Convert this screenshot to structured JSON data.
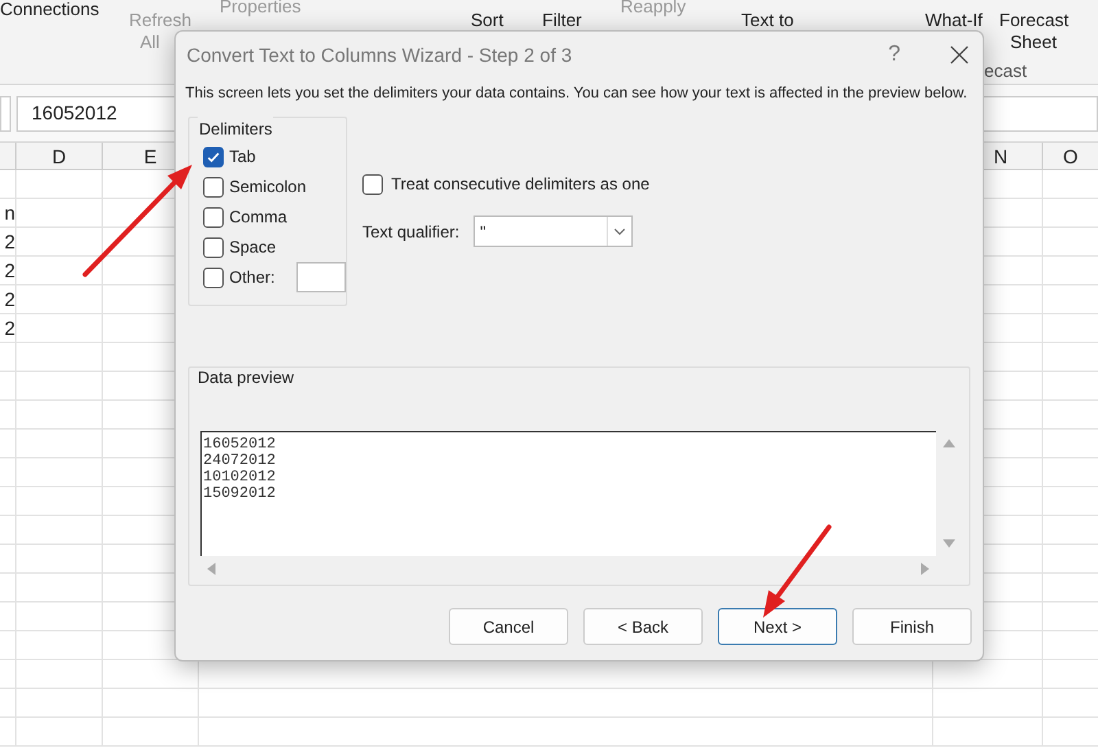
{
  "ribbon": {
    "items": [
      {
        "label": "Connections"
      },
      {
        "label": "Refresh"
      },
      {
        "label": "All"
      },
      {
        "label": "Properties"
      },
      {
        "label": "Sort"
      },
      {
        "label": "Filter"
      },
      {
        "label": "Reapply"
      },
      {
        "label": "Text to"
      },
      {
        "label": "What-If"
      },
      {
        "label": "Forecast"
      },
      {
        "label": "Sheet"
      },
      {
        "label": "ecast"
      }
    ]
  },
  "formula_bar": {
    "value": "16052012"
  },
  "sheet": {
    "columns": [
      "D",
      "E",
      "N",
      "O"
    ],
    "cells": [
      "n",
      "2",
      "2",
      "2",
      "2"
    ]
  },
  "dialog": {
    "title": "Convert Text to Columns Wizard - Step 2 of 3",
    "help": "?",
    "description": "This screen lets you set the delimiters your data contains.  You can see how your text is affected in the preview below.",
    "delimiters": {
      "title": "Delimiters",
      "options": [
        {
          "label": "Tab",
          "checked": true
        },
        {
          "label": "Semicolon",
          "checked": false
        },
        {
          "label": "Comma",
          "checked": false
        },
        {
          "label": "Space",
          "checked": false
        },
        {
          "label": "Other:",
          "checked": false
        }
      ]
    },
    "consecutive": {
      "label": "Treat consecutive delimiters as one",
      "checked": false
    },
    "qualifier": {
      "label": "Text qualifier:",
      "value": "\""
    },
    "preview": {
      "title": "Data preview",
      "lines": [
        "16052012",
        "24072012",
        "10102012",
        "15092012"
      ]
    },
    "buttons": [
      {
        "label": "Cancel",
        "selected": false
      },
      {
        "label": "< Back",
        "selected": false
      },
      {
        "label": "Next >",
        "selected": true
      },
      {
        "label": "Finish",
        "selected": false
      }
    ]
  }
}
